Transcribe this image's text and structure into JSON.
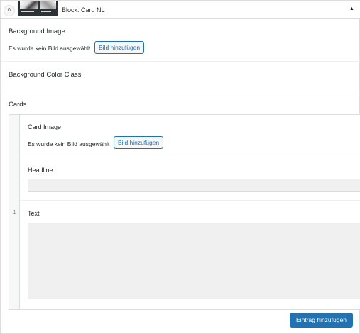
{
  "block": {
    "order": "0",
    "title": "Block: Card NL",
    "toggle_icon": "arrow-up-icon"
  },
  "fields": {
    "background_image": {
      "label": "Background Image",
      "status": "Es wurde kein Bild ausgewählt",
      "button": "Bild hinzufügen"
    },
    "background_color_class": {
      "label": "Background Color Class"
    },
    "cards": {
      "label": "Cards",
      "rows": [
        {
          "number": "1",
          "card_image": {
            "label": "Card Image",
            "status": "Es wurde kein Bild ausgewählt",
            "button": "Bild hinzufügen"
          },
          "headline": {
            "label": "Headline",
            "value": ""
          },
          "text": {
            "label": "Text",
            "value": ""
          }
        }
      ],
      "add_button": "Eintrag hinzufügen"
    }
  },
  "colors": {
    "accent": "#2271b1",
    "border": "#dcdcde",
    "input_bg": "#f0f0f0"
  }
}
